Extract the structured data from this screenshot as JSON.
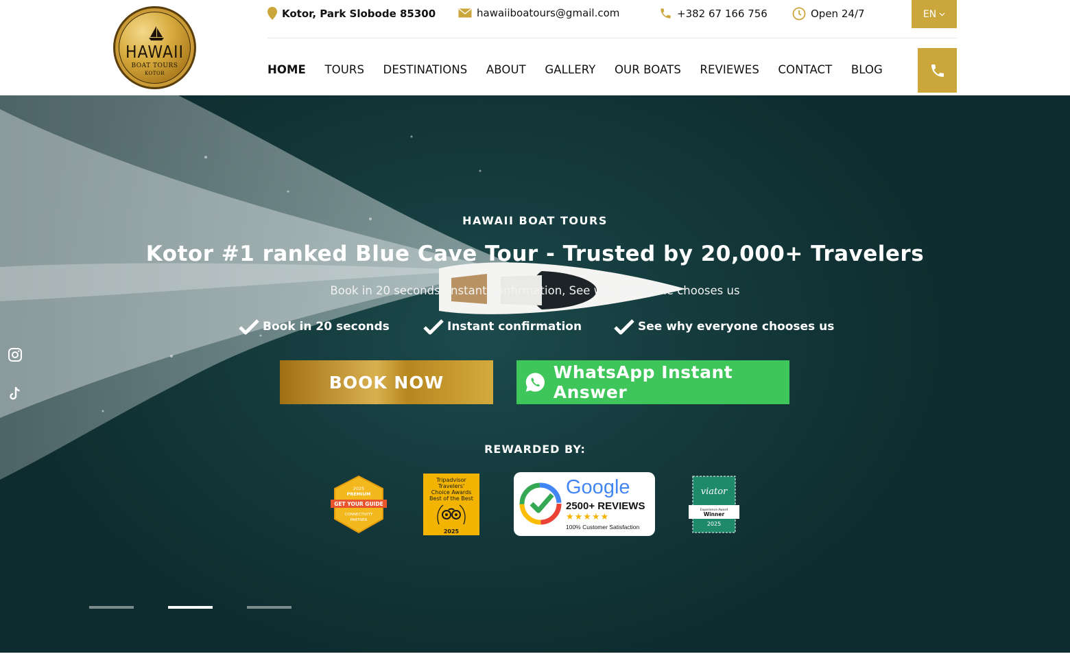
{
  "logo": {
    "line1": "HAWAII",
    "line2": "BOAT TOURS",
    "line3": "KOTOR"
  },
  "topbar": {
    "address": "Kotor, Park Slobode 85300",
    "email": "hawaiiboatours@gmail.com",
    "phone": "+382 67 166 756",
    "hours": "Open 24/7",
    "language": "EN"
  },
  "nav": [
    "HOME",
    "TOURS",
    "DESTINATIONS",
    "ABOUT",
    "GALLERY",
    "OUR BOATS",
    "REVIEWES",
    "CONTACT",
    "BLOG"
  ],
  "hero": {
    "eyebrow": "HAWAII BOAT TOURS",
    "headline": "Kotor #1 ranked Blue Cave Tour - Trusted by 20,000+ Travelers",
    "subtitle": "Book in 20 seconds, Instant confirmation, See why everyone chooses us",
    "checks": [
      "Book in 20 seconds",
      "Instant confirmation",
      "See why everyone chooses us"
    ],
    "book_label": "BOOK NOW",
    "whatsapp_label": "WhatsApp Instant Answer",
    "rewarded_label": "REWARDED BY:"
  },
  "badges": {
    "gyg": {
      "l1": "2025",
      "l2": "PREMIUM",
      "l3": "GET YOUR GUIDE",
      "l4": "CONNECTIVITY",
      "l5": "PARTNER"
    },
    "tripadvisor": {
      "l1": "Tripadvisor",
      "l2": "Travelers'",
      "l3": "Choice Awards",
      "l4": "Best of the Best",
      "l5": "2025"
    },
    "google": {
      "word": "Google",
      "reviews": "2500+ REVIEWS",
      "stars": "★★★★★",
      "satisfaction": "100% Customer Satisfaction"
    },
    "viator": {
      "l1": "viator",
      "l2": "Experience Award",
      "l3": "Winner",
      "l4": "2025"
    }
  },
  "slider": {
    "count": 3,
    "active_index": 2
  },
  "colors": {
    "gold": "#cba73b",
    "whatsapp": "#3fc65a",
    "sea": "#153b3d"
  },
  "icons": [
    "location-pin-icon",
    "envelope-icon",
    "phone-icon",
    "clock-icon",
    "chevron-down-icon",
    "instagram-icon",
    "tiktok-icon",
    "whatsapp-icon",
    "checkmark-icon"
  ]
}
